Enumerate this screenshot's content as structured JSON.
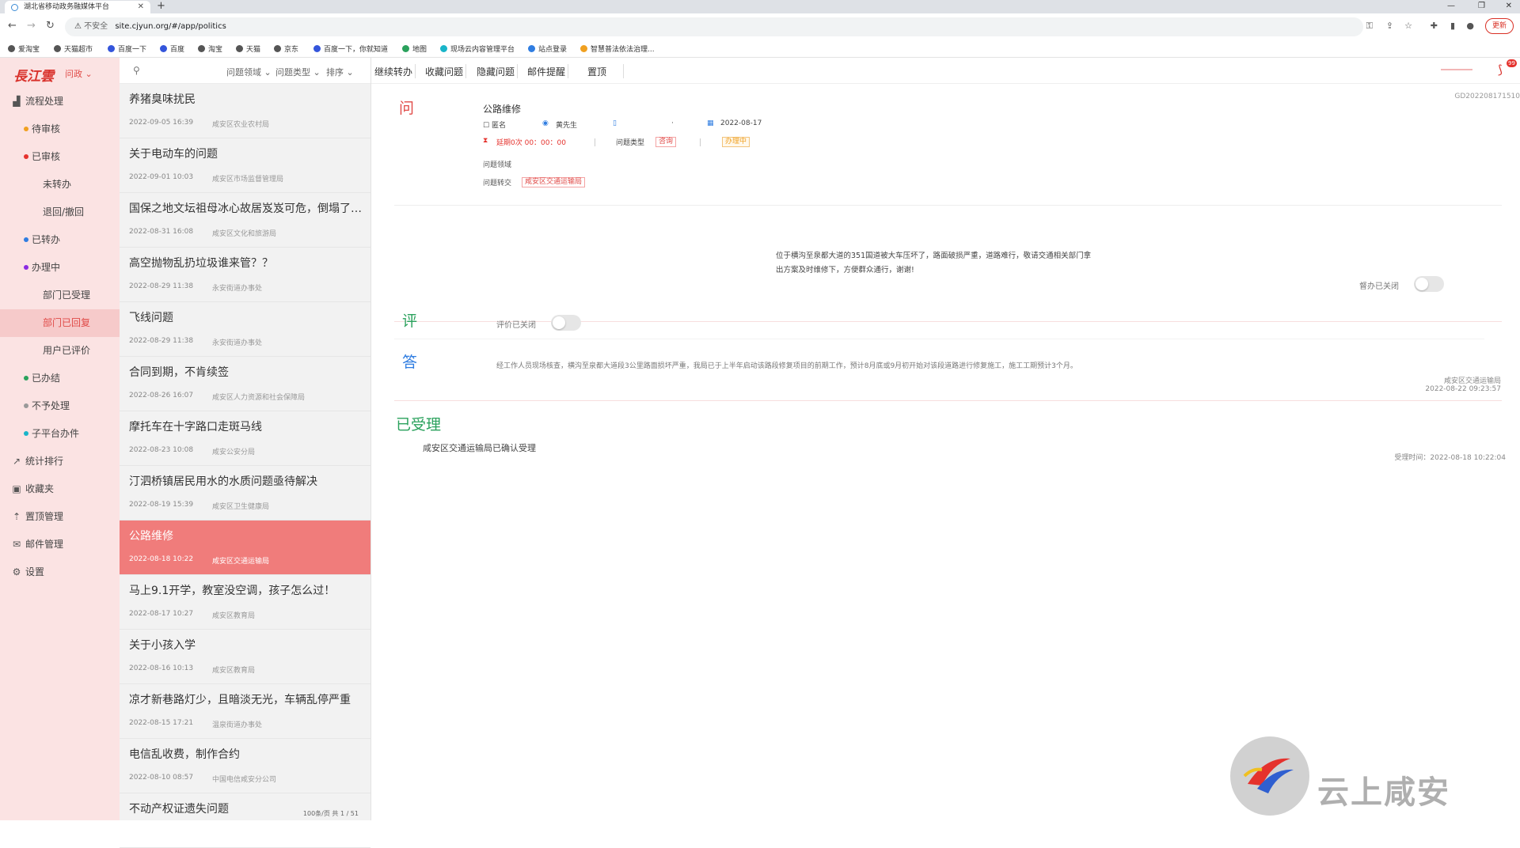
{
  "browser": {
    "tab_title": "湖北省移动政务融媒体平台",
    "url_insecure": "不安全",
    "url": "site.cjyun.org/#/app/politics",
    "update_label": "更新",
    "bookmarks": [
      "爱淘宝",
      "天猫超市",
      "百度一下",
      "百度",
      "淘宝",
      "天猫",
      "京东",
      "百度一下，你就知道",
      "地图",
      "现场云内容管理平台",
      "站点登录",
      "智慧普法依法治理..."
    ]
  },
  "sidebar": {
    "logo": "長江雲",
    "module": "问政",
    "menu": [
      {
        "label": "流程处理",
        "level": 0,
        "icon": "chart-icon"
      },
      {
        "label": "待审核",
        "level": 1,
        "dot": "#f0a020"
      },
      {
        "label": "已审核",
        "level": 1,
        "dot": "#e5322d"
      },
      {
        "label": "未转办",
        "level": 2
      },
      {
        "label": "退回/撤回",
        "level": 2
      },
      {
        "label": "已转办",
        "level": 1,
        "dot": "#2f7de1"
      },
      {
        "label": "办理中",
        "level": 1,
        "dot": "#8a2be2"
      },
      {
        "label": "部门已受理",
        "level": 2
      },
      {
        "label": "部门已回复",
        "level": 2,
        "active": true
      },
      {
        "label": "用户已评价",
        "level": 2
      },
      {
        "label": "已办结",
        "level": 1,
        "dot": "#2aa15c"
      },
      {
        "label": "不予处理",
        "level": 1,
        "dot": "#999999"
      },
      {
        "label": "子平台办件",
        "level": 1,
        "dot": "#19b5c9"
      },
      {
        "label": "统计排行",
        "level": 0,
        "icon": "trend-icon"
      },
      {
        "label": "收藏夹",
        "level": 0,
        "icon": "folder-icon"
      },
      {
        "label": "置顶管理",
        "level": 0,
        "icon": "pin-icon"
      },
      {
        "label": "邮件管理",
        "level": 0,
        "icon": "mail-icon"
      },
      {
        "label": "设置",
        "level": 0,
        "icon": "settings-icon"
      }
    ]
  },
  "filters": {
    "domain": "问题领域",
    "type": "问题类型",
    "sort": "排序"
  },
  "list": [
    {
      "title": "养猪臭味扰民",
      "date": "2022-09-05 16:39",
      "org": "咸安区农业农村局"
    },
    {
      "title": "关于电动车的问题",
      "date": "2022-09-01 10:03",
      "org": "咸安区市场监督管理局"
    },
    {
      "title": "国保之地文坛祖母冰心故居岌岌可危，倒塌了怎么办？",
      "date": "2022-08-31 16:08",
      "org": "咸安区文化和旅游局"
    },
    {
      "title": "高空抛物乱扔垃圾谁来管？？",
      "date": "2022-08-29 11:38",
      "org": "永安街道办事处"
    },
    {
      "title": "飞线问题",
      "date": "2022-08-29 11:38",
      "org": "永安街道办事处"
    },
    {
      "title": "合同到期，不肯续签",
      "date": "2022-08-26 16:07",
      "org": "咸安区人力资源和社会保障局"
    },
    {
      "title": "摩托车在十字路口走斑马线",
      "date": "2022-08-23 10:08",
      "org": "咸安公安分局"
    },
    {
      "title": "汀泗桥镇居民用水的水质问题亟待解决",
      "date": "2022-08-19 15:39",
      "org": "咸安区卫生健康局"
    },
    {
      "title": "公路维修",
      "date": "2022-08-18 10:22",
      "org": "咸安区交通运输局",
      "active": true
    },
    {
      "title": "马上9.1开学，教室没空调，孩子怎么过！",
      "date": "2022-08-17 10:27",
      "org": "咸安区教育局"
    },
    {
      "title": "关于小孩入学",
      "date": "2022-08-16 10:13",
      "org": "咸安区教育局"
    },
    {
      "title": "凉才新巷路灯少，且暗淡无光，车辆乱停严重",
      "date": "2022-08-15 17:21",
      "org": "温泉街道办事处"
    },
    {
      "title": "电信乱收费，制作合约",
      "date": "2022-08-10 08:57",
      "org": "中国电信咸安分公司"
    },
    {
      "title": "不动产权证遗失问题",
      "date": "",
      "org": ""
    }
  ],
  "list_footer": "100条/页  共 1 / 51",
  "toolbar": [
    "继续转办",
    "收藏问题",
    "隐藏问题",
    "邮件提醒",
    "置顶"
  ],
  "notification_count": "99",
  "detail": {
    "ticket_id": "GD202208171510",
    "question_char": "问",
    "title": "公路维修",
    "anonymous": "匿名",
    "user": "黄先生",
    "phone": "·",
    "date": "2022-08-17",
    "delay": "延期0次 00：00：00",
    "type_label": "问题类型",
    "type_value": "咨询",
    "status": "办理中",
    "domain_label": "问题领域",
    "transfer_label": "问题转交",
    "transfer_value": "咸安区交通运输局",
    "content_line1": "位于横沟至泉都大道的351国道被大车压坏了，路面破损严重，道路难行，敬请交通相关部门拿",
    "content_line2": "出方案及时维修下，方便群众通行，谢谢!",
    "supervise_label": "督办已关闭",
    "review_char": "评",
    "review_label": "评价已关闭",
    "answer_char": "答",
    "answer_text": "经工作人员现场核查，横沟至泉都大道段3公里路面损坏严重，我局已于上半年启动该路段修复项目的前期工作，预计8月底或9月初开始对该段道路进行修复施工，施工工期预计3个月。",
    "answer_org": "咸安区交通运输局",
    "answer_time": "2022-08-22 09:23:57",
    "accepted_title": "已受理",
    "accepted_text": "咸安区交通运输局已确认受理",
    "accepted_time": "受理时间：2022-08-18 10:22:04"
  },
  "watermark": "云上咸安"
}
